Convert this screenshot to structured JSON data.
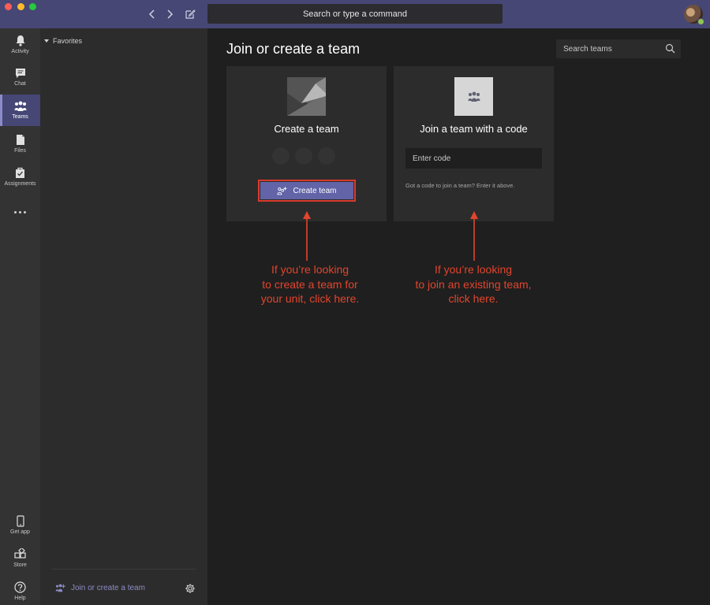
{
  "titlebar": {
    "command_search": "Search or type a command"
  },
  "rail": {
    "items": [
      {
        "label": "Activity",
        "icon": "bell-icon"
      },
      {
        "label": "Chat",
        "icon": "chat-icon"
      },
      {
        "label": "Teams",
        "icon": "teams-icon",
        "active": true
      },
      {
        "label": "Files",
        "icon": "file-icon"
      },
      {
        "label": "Assignments",
        "icon": "assignments-icon"
      }
    ],
    "bottom": [
      {
        "label": "Get app",
        "icon": "phone-icon"
      },
      {
        "label": "Store",
        "icon": "store-icon"
      },
      {
        "label": "Help",
        "icon": "help-icon"
      }
    ]
  },
  "panel": {
    "favorites": "Favorites",
    "join_link": "Join or create a team"
  },
  "main": {
    "title": "Join or create a team",
    "search_placeholder": "Search teams",
    "create_card": {
      "title": "Create a team",
      "button": "Create team"
    },
    "join_card": {
      "title": "Join a team with a code",
      "input_placeholder": "Enter code",
      "hint": "Got a code to join a team? Enter it above."
    }
  },
  "annotations": {
    "left": [
      "If you’re looking",
      "to create a team for",
      "your unit, click here."
    ],
    "right": [
      "If you’re looking",
      "to join an existing team,",
      "click here."
    ]
  },
  "colors": {
    "titlebar": "#464775",
    "accent": "#6264a7",
    "annotation": "#e2452d"
  }
}
